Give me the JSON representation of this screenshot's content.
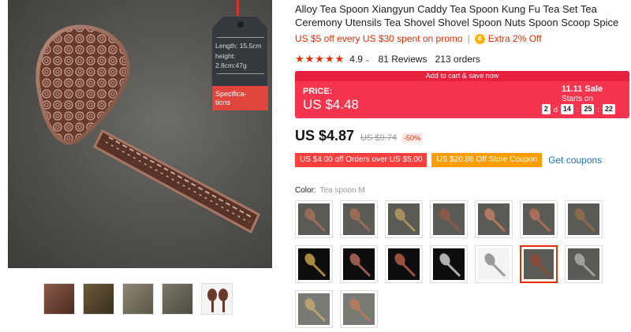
{
  "product": {
    "title": "Alloy Tea Spoon Xiangyun Caddy Tea Spoon Kung Fu Tea Set Tea Ceremony Utensils Tea Shovel Shovel Spoon Nuts Spoon Scoop Spice"
  },
  "spec_tag": {
    "length": "Length: 15.5cm",
    "height_line1": "height:",
    "height_line2": "2.8cm:47g",
    "button_line1": "Specifica-",
    "button_line2": "tions"
  },
  "promo": {
    "text": "US $5 off every US $30 spent on promo",
    "separator": "|",
    "coin_icon": "coin-icon",
    "extra": "Extra 2% Off"
  },
  "rating": {
    "stars": "★★★★★",
    "value": "4.9",
    "caret": "⌄",
    "reviews": "81 Reviews",
    "orders": "213 orders"
  },
  "banner": {
    "top_strip": "Add to cart & save now",
    "price_label": "PRICE:",
    "price_value": "US $4.48",
    "sale_title": "11.11 Sale",
    "starts_on": "Starts on",
    "countdown": {
      "days": "2",
      "d_label": "d",
      "hours": "14",
      "minutes": "25",
      "seconds": "22",
      "colon": ":"
    },
    "color": "#f4354d"
  },
  "price": {
    "current": "US $4.87",
    "original": "US $9.74",
    "discount": "-50%"
  },
  "coupons": {
    "coupon1": "US $4.00 off Orders over US $5.00",
    "coupon2": "US $20.86 Off Store Coupon",
    "get": "Get coupons"
  },
  "color": {
    "label": "Color:",
    "value": "Tea spoon M",
    "selected_index": 12
  },
  "accent_color": "#e62e04"
}
